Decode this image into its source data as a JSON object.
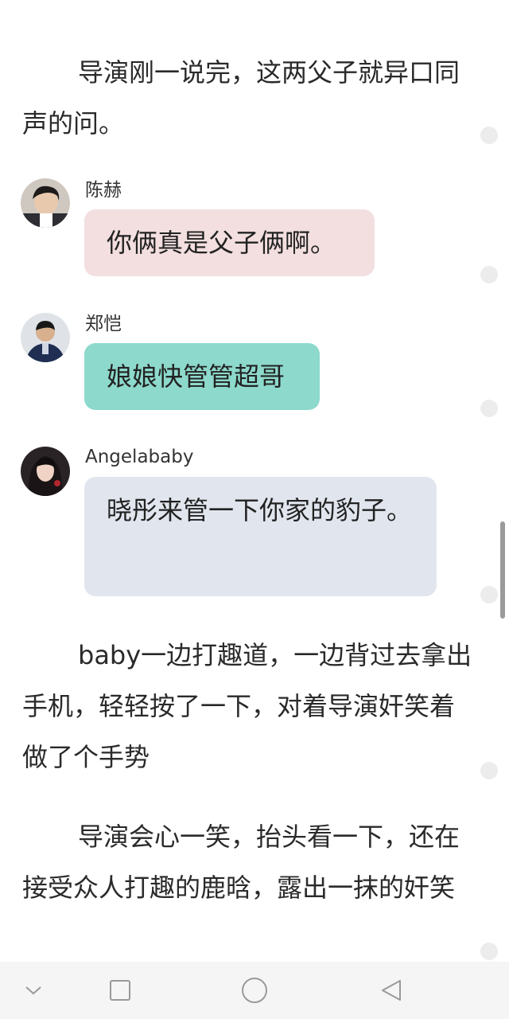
{
  "paragraphs": {
    "p1": "导演刚一说完，这两父子就异口同声的问。",
    "p2": "baby一边打趣道，一边背过去拿出手机，轻轻按了一下，对着导演奸笑着做了个手势",
    "p3": "导演会心一笑，抬头看一下，还在接受众人打趣的鹿晗，露出一抹的奸笑"
  },
  "messages": [
    {
      "speaker": "陈赫",
      "text": "你俩真是父子俩啊。",
      "bubble_color": "#f3dfe0"
    },
    {
      "speaker": "郑恺",
      "text": "娘娘快管管超哥",
      "bubble_color": "#8dd9cc"
    },
    {
      "speaker": "Angelababy",
      "text": "晓彤来管一下你家的豹子。",
      "bubble_color": "#e1e6ee"
    }
  ],
  "navbar": {
    "icons": [
      "chevron-down-icon",
      "recents-square-icon",
      "home-circle-icon",
      "back-triangle-icon"
    ]
  }
}
